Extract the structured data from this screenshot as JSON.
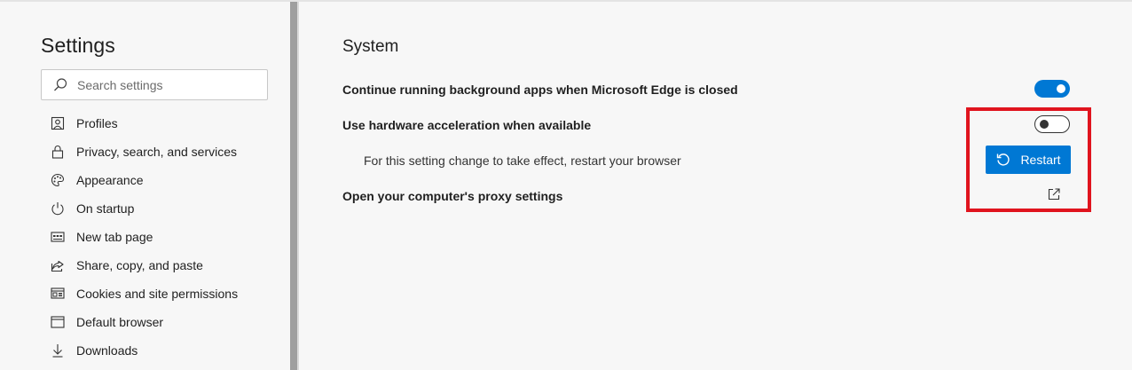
{
  "sidebar": {
    "title": "Settings",
    "search": {
      "placeholder": "Search settings",
      "icon": "search-icon"
    },
    "items": [
      {
        "label": "Profiles",
        "icon": "profile-icon"
      },
      {
        "label": "Privacy, search, and services",
        "icon": "lock-icon"
      },
      {
        "label": "Appearance",
        "icon": "palette-icon"
      },
      {
        "label": "On startup",
        "icon": "power-icon"
      },
      {
        "label": "New tab page",
        "icon": "new-tab-icon"
      },
      {
        "label": "Share, copy, and paste",
        "icon": "share-icon"
      },
      {
        "label": "Cookies and site permissions",
        "icon": "cookies-icon"
      },
      {
        "label": "Default browser",
        "icon": "browser-icon"
      },
      {
        "label": "Downloads",
        "icon": "download-icon"
      }
    ]
  },
  "main": {
    "section_title": "System",
    "settings": [
      {
        "label": "Continue running background apps when Microsoft Edge is closed",
        "toggle": "on"
      },
      {
        "label": "Use hardware acceleration when available",
        "toggle": "off",
        "note": "For this setting change to take effect, restart your browser",
        "button_label": "Restart"
      },
      {
        "label": "Open your computer's proxy settings",
        "icon": "external-link-icon"
      }
    ]
  },
  "colors": {
    "accent": "#0078d4",
    "highlight": "#e0141e",
    "background": "#f7f7f7"
  }
}
